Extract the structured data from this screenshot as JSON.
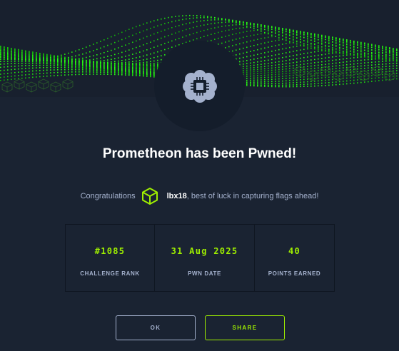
{
  "dialog": {
    "title": "Prometheon has been Pwned!",
    "congrats_prefix": "Congratulations",
    "username": "lbx18",
    "congrats_suffix": ", best of luck in capturing flags ahead!",
    "avatar_icon": "processor-chip-icon",
    "user_icon": "cube-icon"
  },
  "stats": [
    {
      "value": "#1085",
      "label": "CHALLENGE RANK"
    },
    {
      "value": "31 Aug 2025",
      "label": "PWN DATE"
    },
    {
      "value": "40",
      "label": "POINTS EARNED"
    }
  ],
  "buttons": {
    "ok": "OK",
    "share": "SHARE"
  },
  "colors": {
    "accent": "#9fef00",
    "background": "#1a2332",
    "muted_text": "#a4b1cd"
  }
}
